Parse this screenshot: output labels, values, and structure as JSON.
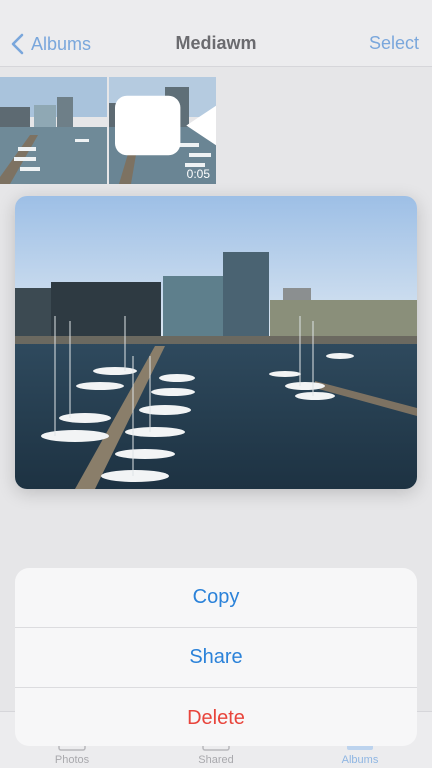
{
  "navbar": {
    "back_label": "Albums",
    "title": "Mediawm",
    "select_label": "Select"
  },
  "thumbnails": [
    {
      "kind": "photo"
    },
    {
      "kind": "video",
      "duration": "0:05"
    }
  ],
  "menu": {
    "items": [
      {
        "label": "Copy",
        "style": "default"
      },
      {
        "label": "Share",
        "style": "default"
      },
      {
        "label": "Delete",
        "style": "destructive"
      }
    ]
  },
  "tabbar": {
    "items": [
      {
        "label": "Photos",
        "active": false
      },
      {
        "label": "Shared",
        "active": false
      },
      {
        "label": "Albums",
        "active": true
      }
    ]
  },
  "colors": {
    "accent": "#2b82d9",
    "destructive": "#e8453c",
    "navbar_accent_dimmed": "#7aa7dc"
  }
}
